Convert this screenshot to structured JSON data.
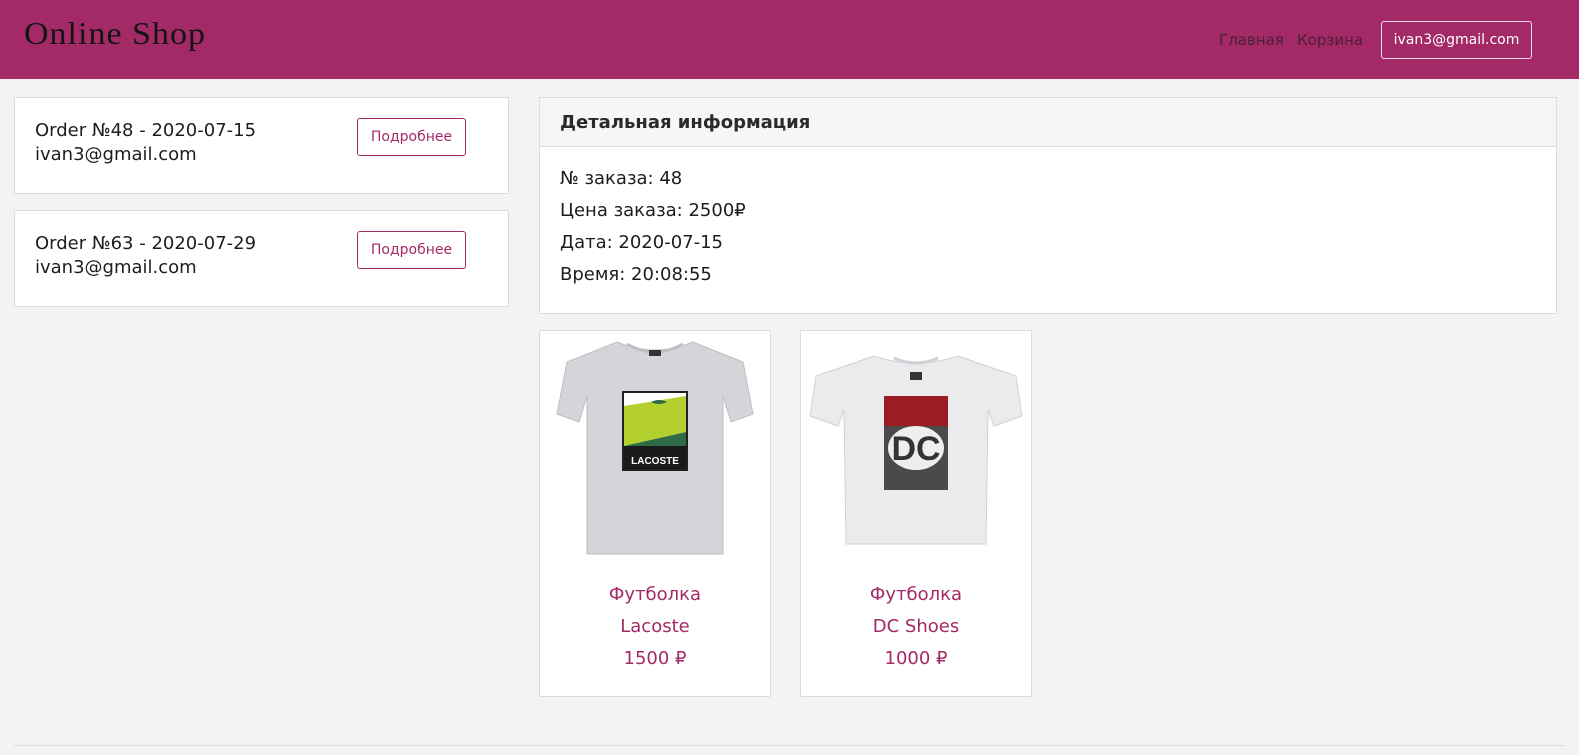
{
  "header": {
    "brand": "Online Shop",
    "nav_home": "Главная",
    "nav_cart": "Корзина",
    "user_email": "ivan3@gmail.com"
  },
  "orders": [
    {
      "title": "Order №48 - 2020-07-15",
      "email": "ivan3@gmail.com",
      "button_label": "Подробнее"
    },
    {
      "title": "Order №63 - 2020-07-29",
      "email": "ivan3@gmail.com",
      "button_label": "Подробнее"
    }
  ],
  "detail": {
    "header": "Детальная информация",
    "order_number": "№ заказа: 48",
    "order_price": "Цена заказа: 2500₽",
    "order_date": "Дата: 2020-07-15",
    "order_time": "Время: 20:08:55"
  },
  "products": [
    {
      "name": "Футболка",
      "brand": "Lacoste",
      "price": "1500 ₽",
      "image_icon": "lacoste-tshirt-image",
      "graphic_text": "LACOSTE"
    },
    {
      "name": "Футболка",
      "brand": "DC Shoes",
      "price": "1000 ₽",
      "image_icon": "dc-shoes-tshirt-image",
      "graphic_text": "DC"
    }
  ],
  "colors": {
    "accent": "#a32a66",
    "background": "#f3f3f3",
    "card": "#ffffff"
  }
}
